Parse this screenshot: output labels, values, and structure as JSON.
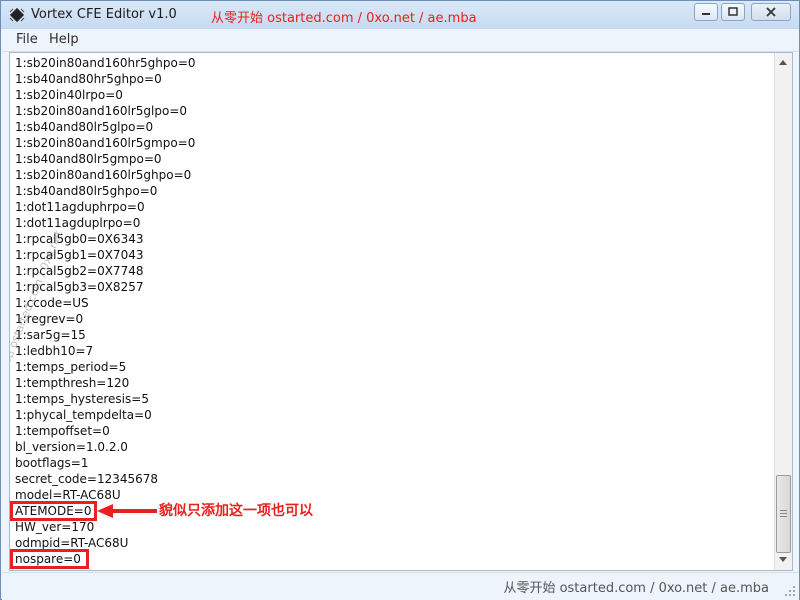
{
  "window": {
    "title": "Vortex CFE Editor v1.0",
    "title_watermark": "从零开始 ostarted.com / 0xo.net / ae.mba"
  },
  "menu": [
    "File",
    "Help"
  ],
  "editor": {
    "lines": [
      "1:sb20in80and160hr5ghpo=0",
      "1:sb40and80hr5ghpo=0",
      "1:sb20in40lrpo=0",
      "1:sb20in80and160lr5glpo=0",
      "1:sb40and80lr5glpo=0",
      "1:sb20in80and160lr5gmpo=0",
      "1:sb40and80lr5gmpo=0",
      "1:sb20in80and160lr5ghpo=0",
      "1:sb40and80lr5ghpo=0",
      "1:dot11agduphrpo=0",
      "1:dot11agduplrpo=0",
      "1:rpcal5gb0=0X6343",
      "1:rpcal5gb1=0X7043",
      "1:rpcal5gb2=0X7748",
      "1:rpcal5gb3=0X8257",
      "1:ccode=US",
      "1:regrev=0",
      "1:sar5g=15",
      "1:ledbh10=7",
      "1:temps_period=5",
      "1:tempthresh=120",
      "1:temps_hysteresis=5",
      "1:phycal_tempdelta=0",
      "1:tempoffset=0",
      "bl_version=1.0.2.0",
      "bootflags=1",
      "secret_code=12345678",
      "model=RT-AC68U",
      "ATEMODE=0",
      "HW_ver=170",
      "odmpid=RT-AC68U",
      "nospare=0"
    ],
    "diagonal_watermark": "从零开始 ostarted.com / 0xo.net"
  },
  "annotation": {
    "text": "貌似只添加这一项也可以",
    "color": "#e8201f"
  },
  "statusbar": {
    "watermark": "从零开始 ostarted.com / 0xo.net / ae.mba"
  },
  "scroll": {
    "position_fraction": 1.0
  }
}
